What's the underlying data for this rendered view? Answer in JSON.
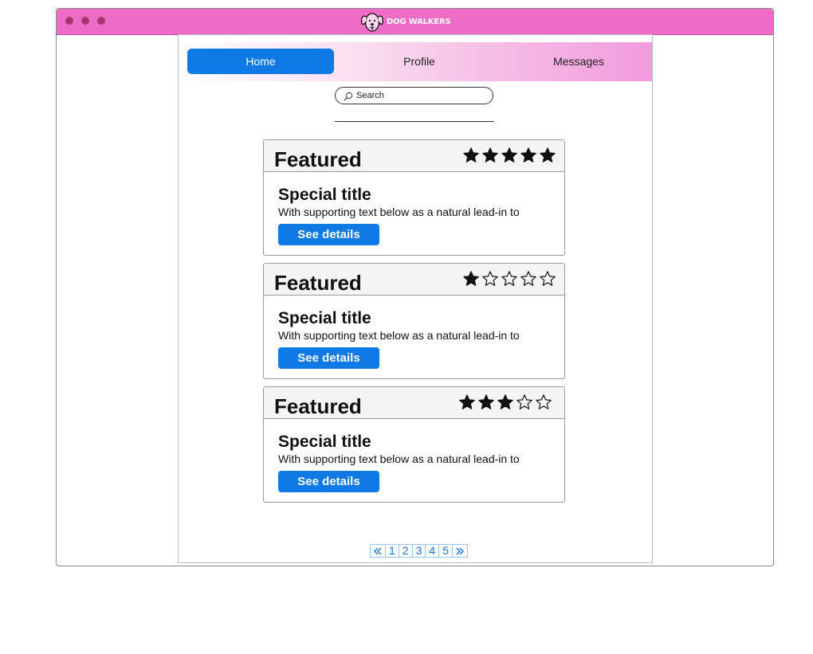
{
  "app": {
    "brand": "DOG WALKERS"
  },
  "nav": {
    "items": [
      "Home",
      "Profile",
      "Messages"
    ],
    "active": "Home"
  },
  "search": {
    "placeholder": "Search"
  },
  "cards": [
    {
      "header": "Featured",
      "rating": 5,
      "title": "Special title",
      "text": "With supporting text below as a natural lead-in to",
      "button": "See details"
    },
    {
      "header": "Featured",
      "rating": 1,
      "title": "Special title",
      "text": "With supporting text below as a natural lead-in to",
      "button": "See details"
    },
    {
      "header": "Featured",
      "rating": 3,
      "title": "Special title",
      "text": "With supporting text below as a natural lead-in to",
      "button": "See details"
    }
  ],
  "pagination": {
    "pages": [
      "1",
      "2",
      "3",
      "4",
      "5"
    ]
  },
  "colors": {
    "titlebar": "#ee6bc8",
    "accent": "#0f7ae5"
  }
}
